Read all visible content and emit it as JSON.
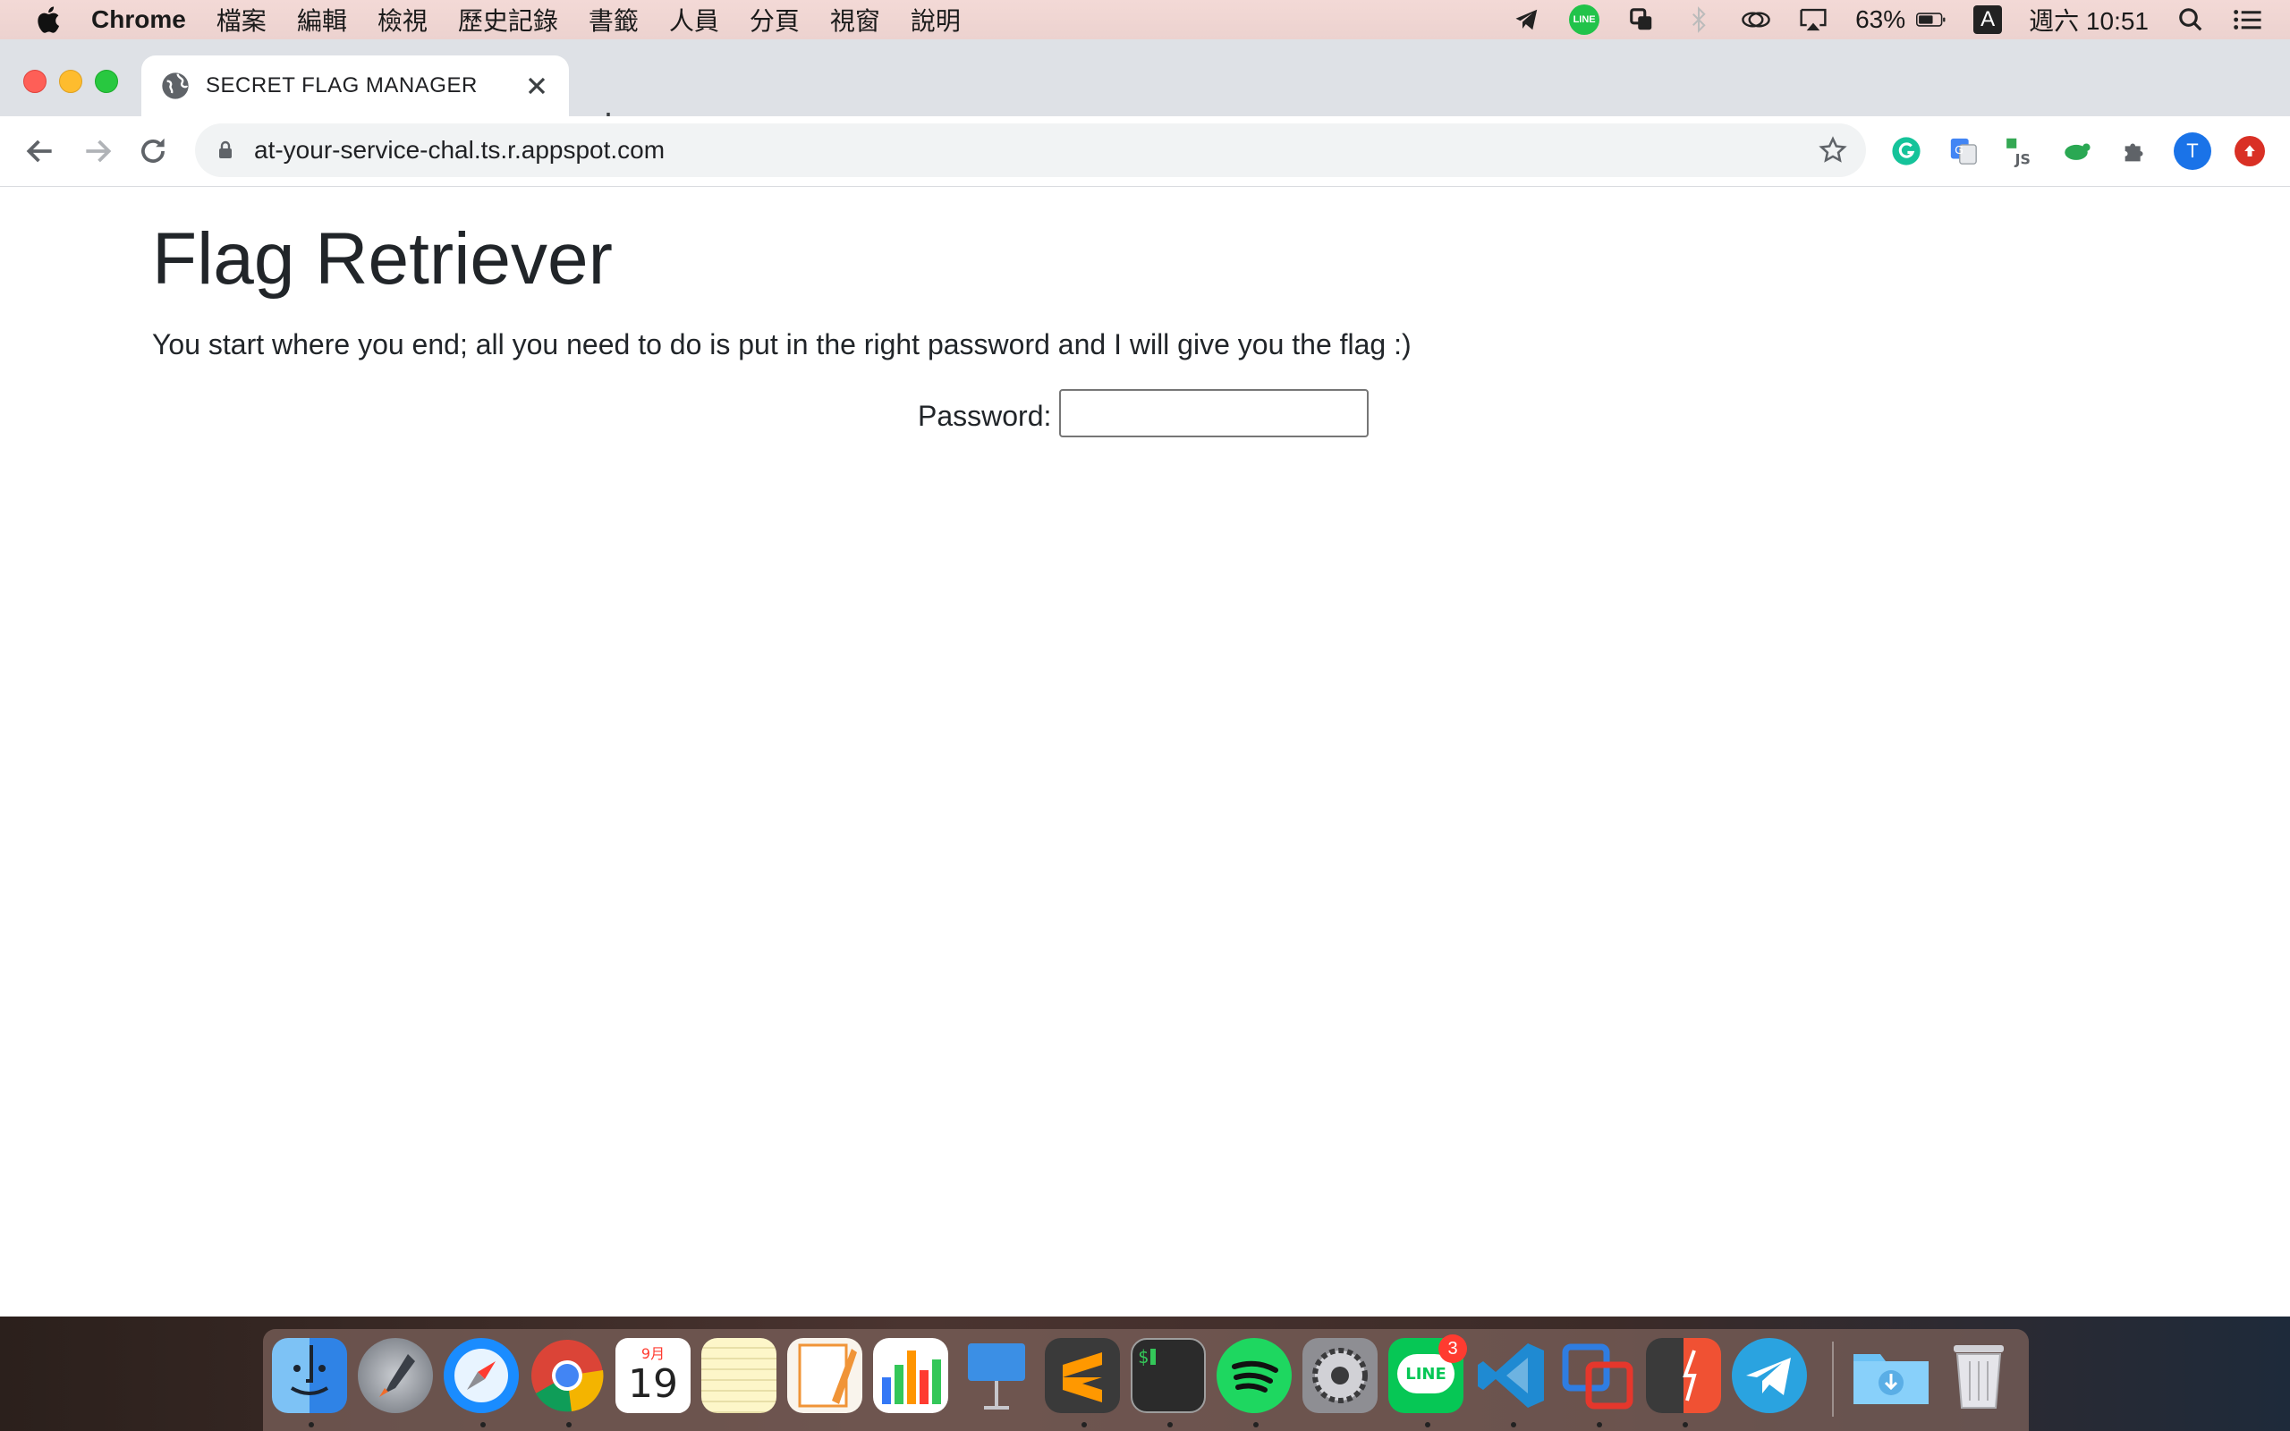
{
  "menubar": {
    "app_name": "Chrome",
    "menus": [
      "檔案",
      "編輯",
      "檢視",
      "歷史記錄",
      "書籤",
      "人員",
      "分頁",
      "視窗",
      "說明"
    ],
    "line_label": "LINE",
    "battery": "63%",
    "input_source": "A",
    "clock": "週六 10:51"
  },
  "browser": {
    "tab_title": "SECRET FLAG MANAGER",
    "url": "at-your-service-chal.ts.r.appspot.com",
    "profile_initial": "T"
  },
  "page": {
    "heading": "Flag Retriever",
    "lead": "You start where you end; all you need to do is put in the right password and I will give you the flag :)",
    "password_label": "Password:",
    "password_value": ""
  },
  "dock": {
    "calendar_month": "9月",
    "calendar_day": "19",
    "line_badge": "3",
    "line_label": "LINE"
  }
}
